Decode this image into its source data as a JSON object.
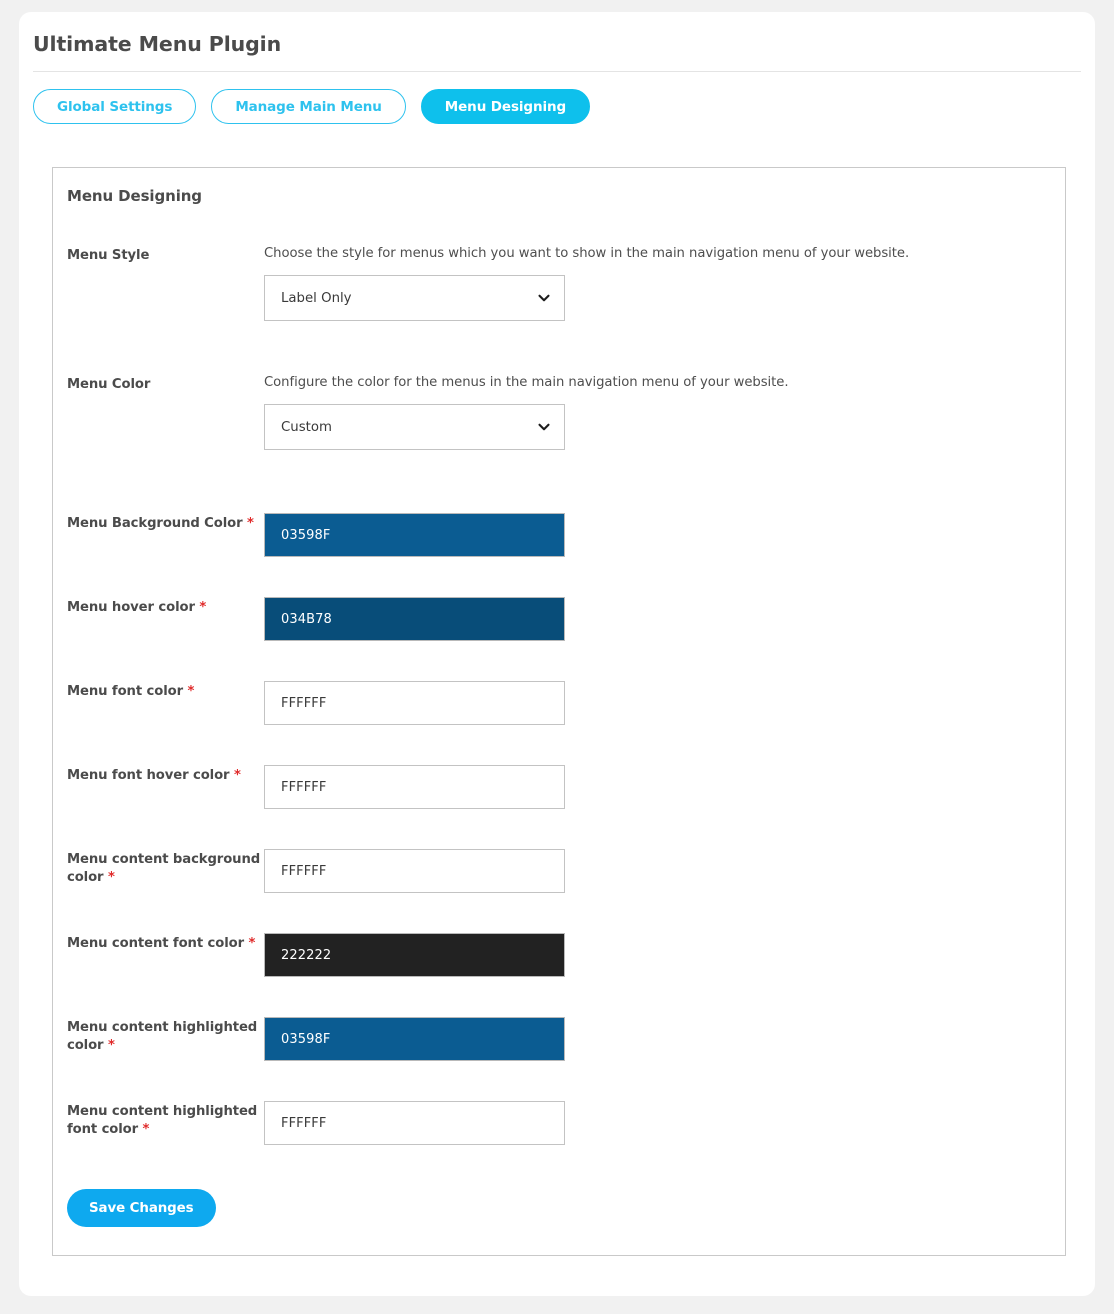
{
  "page": {
    "title": "Ultimate Menu Plugin"
  },
  "tabs": [
    {
      "label": "Global Settings",
      "active": false
    },
    {
      "label": "Manage Main Menu",
      "active": false
    },
    {
      "label": "Menu Designing",
      "active": true
    }
  ],
  "panel": {
    "title": "Menu Designing"
  },
  "fields": {
    "menu_style": {
      "label": "Menu Style",
      "description": "Choose the style for menus which you want to show in the main navigation menu of your website.",
      "value": "Label Only",
      "options": [
        "Label Only"
      ]
    },
    "menu_color": {
      "label": "Menu Color",
      "description": "Configure the color for the menus in the main navigation menu of your website.",
      "value": "Custom",
      "options": [
        "Custom"
      ]
    },
    "menu_background_color": {
      "label": "Menu Background Color",
      "required": "*",
      "value": "03598F",
      "swatch": "#0b5c92",
      "text_color": "#ffffff"
    },
    "menu_hover_color": {
      "label": "Menu hover color",
      "required": "*",
      "value": "034B78",
      "swatch": "#084d79",
      "text_color": "#ffffff"
    },
    "menu_font_color": {
      "label": "Menu font color",
      "required": "*",
      "value": "FFFFFF",
      "swatch": "#ffffff",
      "text_color": "#3a3a3a"
    },
    "menu_font_hover_color": {
      "label": "Menu font hover color",
      "required": "*",
      "value": "FFFFFF",
      "swatch": "#ffffff",
      "text_color": "#3a3a3a"
    },
    "menu_content_background_color": {
      "label": "Menu content background color",
      "required": "*",
      "value": "FFFFFF",
      "swatch": "#ffffff",
      "text_color": "#3a3a3a"
    },
    "menu_content_font_color": {
      "label": "Menu content font color",
      "required": "*",
      "value": "222222",
      "swatch": "#222222",
      "text_color": "#ffffff"
    },
    "menu_content_highlighted_color": {
      "label": "Menu content highlighted color",
      "required": "*",
      "value": "03598F",
      "swatch": "#0b5c92",
      "text_color": "#ffffff"
    },
    "menu_content_highlighted_font_color": {
      "label": "Menu content highlighted font color",
      "required": "*",
      "value": "FFFFFF",
      "swatch": "#ffffff",
      "text_color": "#3a3a3a"
    }
  },
  "footer": {
    "save_label": "Save Changes"
  },
  "theme": {
    "accent": "#0ec0ec",
    "accent_outline": "#2ec2ee",
    "save_button": "#0ea9ef",
    "required_marker": "#e02b2b",
    "page_background": "#f1f1f1",
    "card_background": "#ffffff"
  }
}
